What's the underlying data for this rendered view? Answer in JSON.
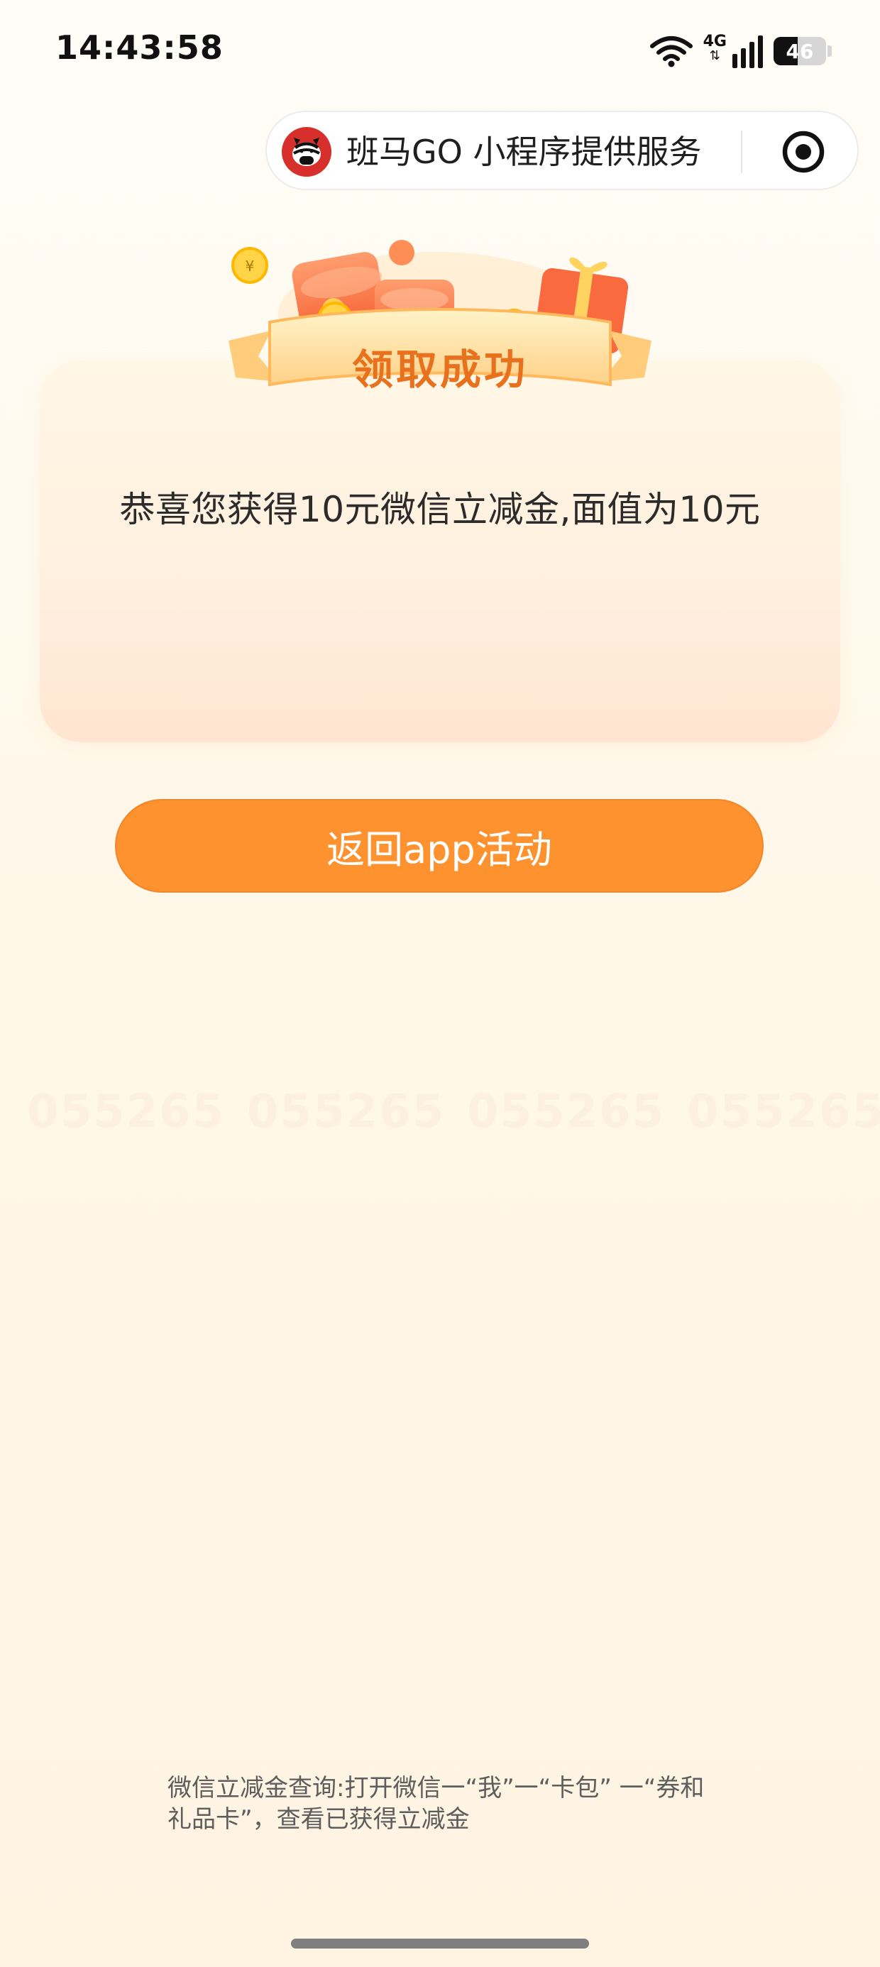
{
  "status_bar": {
    "time": "14:43:58",
    "network": "4G",
    "battery": "46",
    "battery_level": 0.46,
    "icons": [
      "wifi-icon",
      "cellular-signal-icon",
      "battery-icon"
    ]
  },
  "capsule": {
    "title": "班马GO 小程序提供服务",
    "logo_icon": "zebra-logo-icon",
    "action_icon": "target-icon"
  },
  "watermark": {
    "text": "055265"
  },
  "result": {
    "title": "领取成功",
    "message": "恭喜您获得10元微信立减金,面值为10元"
  },
  "actions": {
    "return_label": "返回app活动"
  },
  "footnote": {
    "text": "微信立减金查询:打开微信一“我”一“卡包” 一“券和礼品卡”，查看已获得立减金"
  },
  "colors": {
    "button": "#fd922f",
    "title": "#e8711e",
    "card_top": "#fff7e6",
    "card_bottom": "#ffe5d1",
    "capsule_logo": "#d7302c"
  }
}
